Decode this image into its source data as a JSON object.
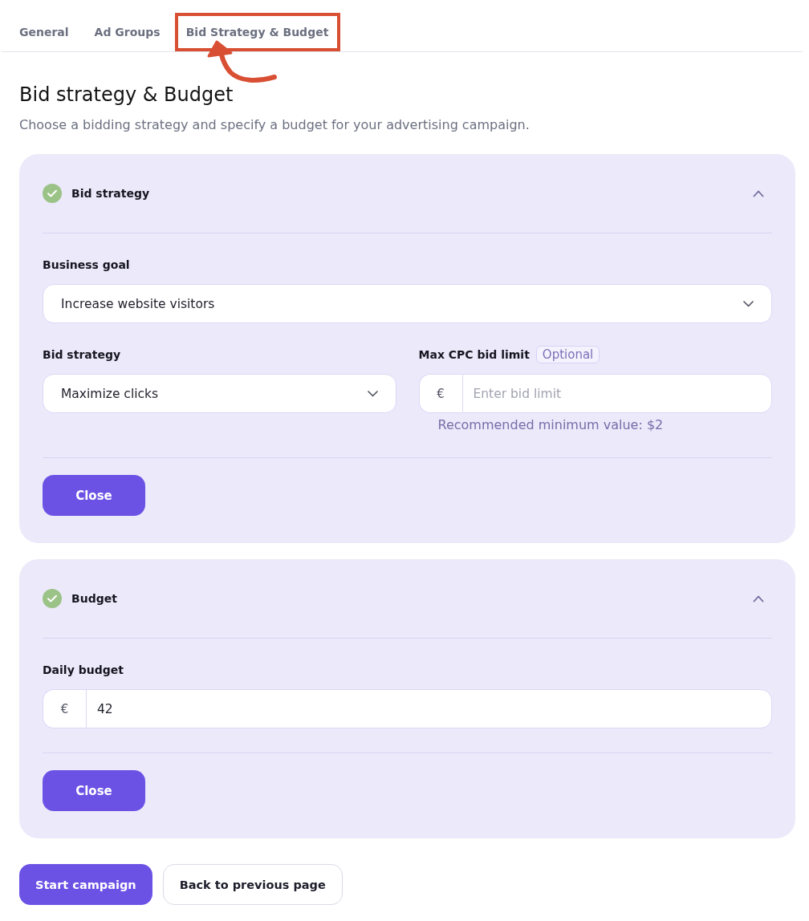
{
  "tabs": [
    {
      "label": "General",
      "selected": false,
      "highlighted": false
    },
    {
      "label": "Ad Groups",
      "selected": false,
      "highlighted": false
    },
    {
      "label": "Bid Strategy & Budget",
      "selected": false,
      "highlighted": true
    }
  ],
  "page": {
    "title": "Bid strategy & Budget",
    "subtitle": "Choose a bidding strategy and specify a budget for your advertising campaign."
  },
  "sections": [
    {
      "title": "Bid strategy",
      "completed": true,
      "expanded": true,
      "rows": [
        [
          {
            "kind": "select",
            "label": "Business goal",
            "value": "Increase website visitors"
          }
        ],
        [
          {
            "kind": "select",
            "label": "Bid strategy",
            "value": "Maximize clicks"
          },
          {
            "kind": "currency_input",
            "label": "Max CPC bid limit",
            "badge": "Optional",
            "prefix": "€",
            "placeholder": "Enter bid limit",
            "hint": "Recommended minimum value: $2"
          }
        ]
      ],
      "close_button": "Close"
    },
    {
      "title": "Budget",
      "completed": true,
      "expanded": true,
      "rows": [
        [
          {
            "kind": "currency_input",
            "label": "Daily budget",
            "prefix": "€",
            "value": "42"
          }
        ]
      ],
      "close_button": "Close"
    }
  ],
  "actions": [
    {
      "label": "Start campaign",
      "kind": "primary"
    },
    {
      "label": "Back to previous page",
      "kind": "secondary"
    }
  ]
}
